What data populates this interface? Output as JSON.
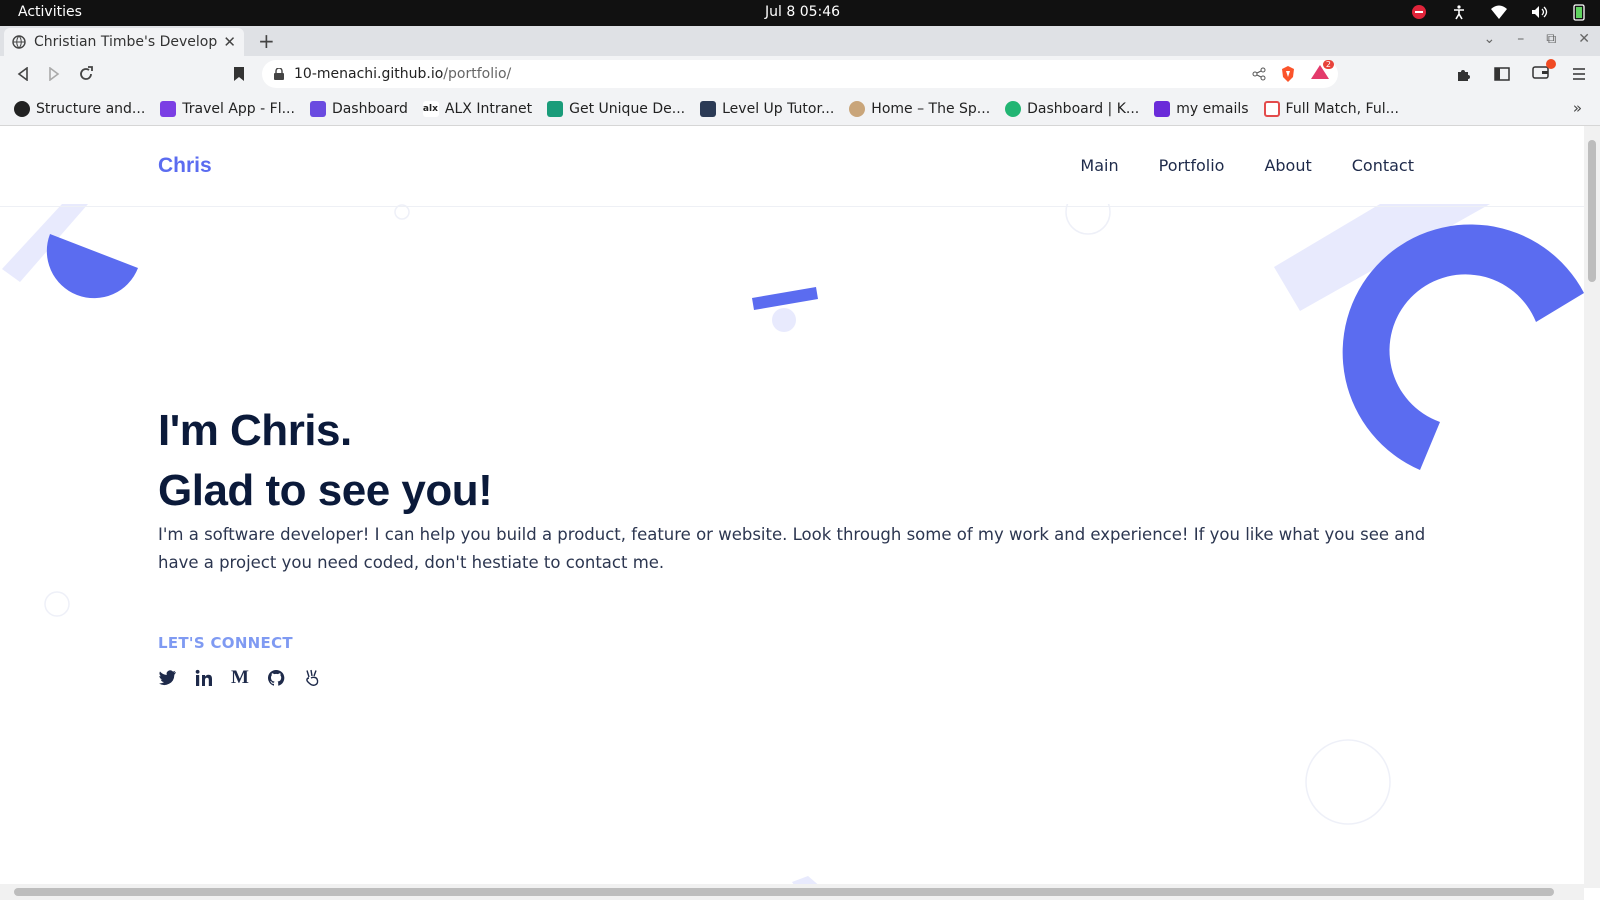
{
  "system_bar": {
    "activities": "Activities",
    "clock": "Jul 8  05:46"
  },
  "browser": {
    "tab_title": "Christian Timbe's Develop",
    "url_host": "10-menachi.github.io",
    "url_path": "/portfolio/",
    "brave_badge": "2",
    "bookmarks": [
      {
        "label": "Structure and...",
        "color": "#222222"
      },
      {
        "label": "Travel App - Fl...",
        "color": "#7b3fe4"
      },
      {
        "label": "Dashboard",
        "color": "#6a4be0"
      },
      {
        "label": "ALX Intranet",
        "color": "#222222"
      },
      {
        "label": "Get Unique De...",
        "color": "#1a9c7a"
      },
      {
        "label": "Level Up Tutor...",
        "color": "#2b3a55"
      },
      {
        "label": "Home – The Sp...",
        "color": "#c9a57a"
      },
      {
        "label": "Dashboard | K...",
        "color": "#22b573"
      },
      {
        "label": "my emails",
        "color": "#6a2bd9"
      },
      {
        "label": "Full Match, Ful...",
        "color": "#e34b4b"
      }
    ]
  },
  "site": {
    "brand": "Chris",
    "nav": [
      "Main",
      "Portfolio",
      "About",
      "Contact"
    ],
    "heading_line1": "I'm Chris.",
    "heading_line2": "Glad to see you!",
    "intro": "I'm a software developer! I can help you build a product, feature or website. Look through some of my work and experience! If you like what you see and have a project you need coded, don't hestiate to contact me.",
    "connect_label": "LET'S CONNECT",
    "socials": [
      "twitter-icon",
      "linkedin-icon",
      "medium-icon",
      "github-icon",
      "angellist-icon"
    ],
    "accent": "#5b6cf0"
  }
}
